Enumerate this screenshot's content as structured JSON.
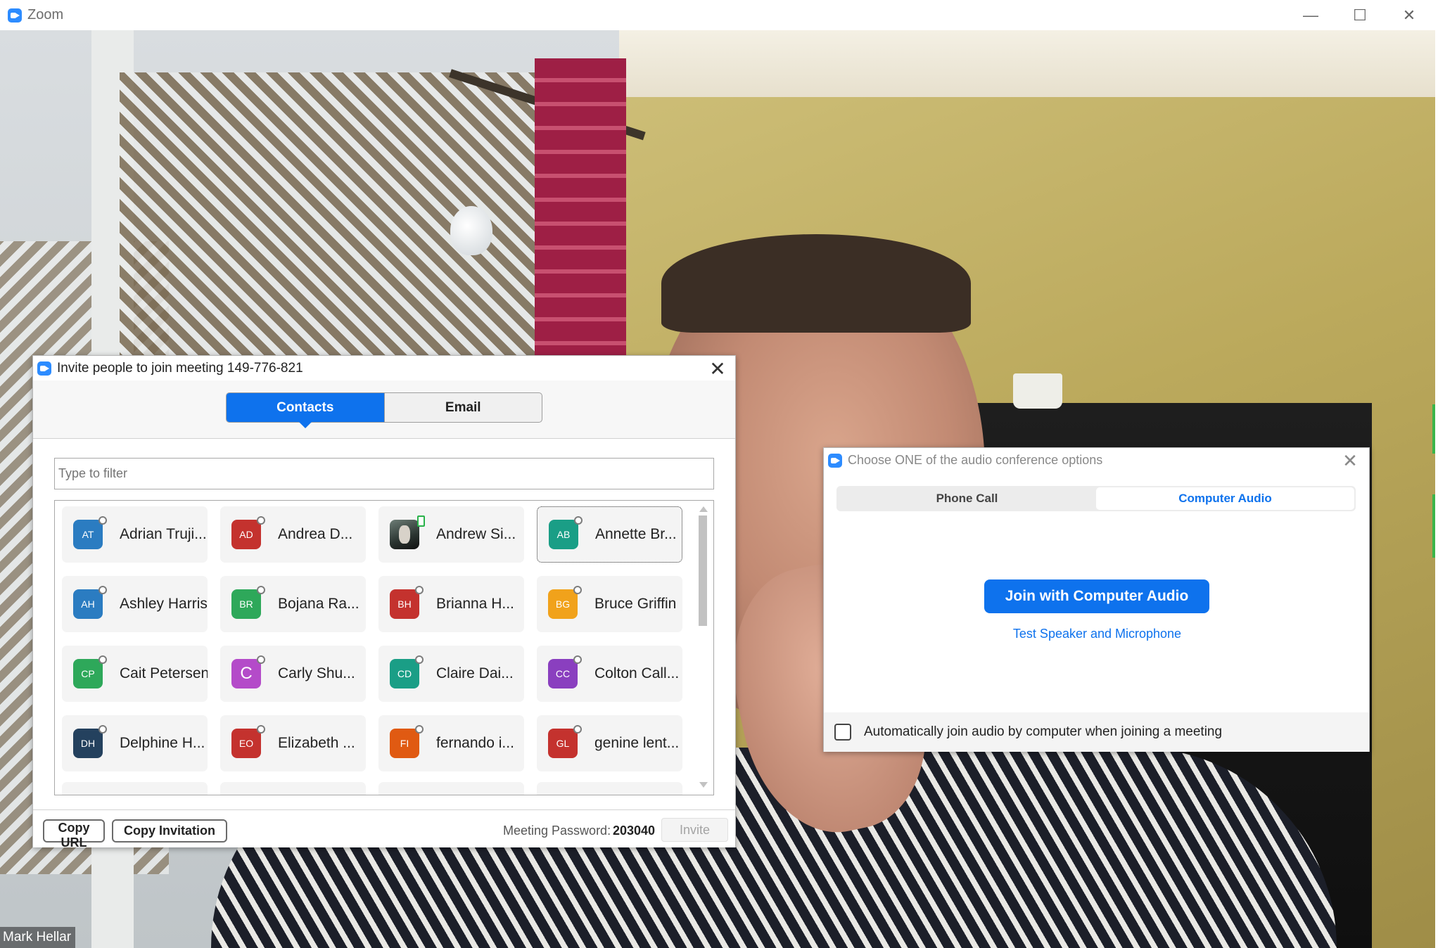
{
  "window": {
    "title": "Zoom",
    "minimize_glyph": "—",
    "maximize_glyph": "☐",
    "close_glyph": "✕"
  },
  "video": {
    "participant_name": "Mark Hellar"
  },
  "invite_dialog": {
    "title": "Invite people to join meeting 149-776-821",
    "close_glyph": "✕",
    "tabs": [
      {
        "label": "Contacts",
        "active": true
      },
      {
        "label": "Email",
        "active": false
      }
    ],
    "filter_placeholder": "Type to filter",
    "contacts": [
      {
        "initials": "AT",
        "name": "Adrian Truji...",
        "color": "#2b7cc1"
      },
      {
        "initials": "AD",
        "name": "Andrea D...",
        "color": "#c4322e"
      },
      {
        "initials": "",
        "name": "Andrew Si...",
        "color": "#2a3430",
        "photo": true,
        "status": "online"
      },
      {
        "initials": "AB",
        "name": "Annette Br...",
        "color": "#1a9e86",
        "selected": true
      },
      {
        "initials": "AH",
        "name": "Ashley Harris",
        "color": "#2b7cc1"
      },
      {
        "initials": "BR",
        "name": "Bojana Ra...",
        "color": "#2ea85a"
      },
      {
        "initials": "BH",
        "name": "Brianna H...",
        "color": "#c4322e"
      },
      {
        "initials": "BG",
        "name": "Bruce Griffin",
        "color": "#f1a21b"
      },
      {
        "initials": "CP",
        "name": "Cait Petersen",
        "color": "#2ea85a"
      },
      {
        "initials": "C",
        "name": "Carly Shu...",
        "color": "#b44bc9"
      },
      {
        "initials": "CD",
        "name": "Claire Dai...",
        "color": "#1a9e86"
      },
      {
        "initials": "CC",
        "name": "Colton Call...",
        "color": "#8a3fbf"
      },
      {
        "initials": "DH",
        "name": "Delphine H...",
        "color": "#24415e"
      },
      {
        "initials": "EO",
        "name": "Elizabeth ...",
        "color": "#c4322e"
      },
      {
        "initials": "FI",
        "name": "fernando i...",
        "color": "#e05a12"
      },
      {
        "initials": "GL",
        "name": "genine lent...",
        "color": "#c4322e"
      }
    ],
    "footer": {
      "copy_url": "Copy URL",
      "copy_invitation": "Copy Invitation",
      "password_label": "Meeting Password:",
      "password_value": "203040",
      "invite": "Invite"
    }
  },
  "audio_dialog": {
    "title": "Choose ONE of the audio conference options",
    "close_glyph": "✕",
    "tabs": [
      {
        "label": "Phone Call",
        "active": false
      },
      {
        "label": "Computer Audio",
        "active": true
      }
    ],
    "join_button": "Join with Computer Audio",
    "test_link": "Test Speaker and Microphone",
    "auto_join_label": "Automatically join audio by computer when joining a meeting",
    "auto_join_checked": false
  },
  "colors": {
    "accent": "#0e72ed",
    "zoom_blue": "#2d8cff"
  }
}
